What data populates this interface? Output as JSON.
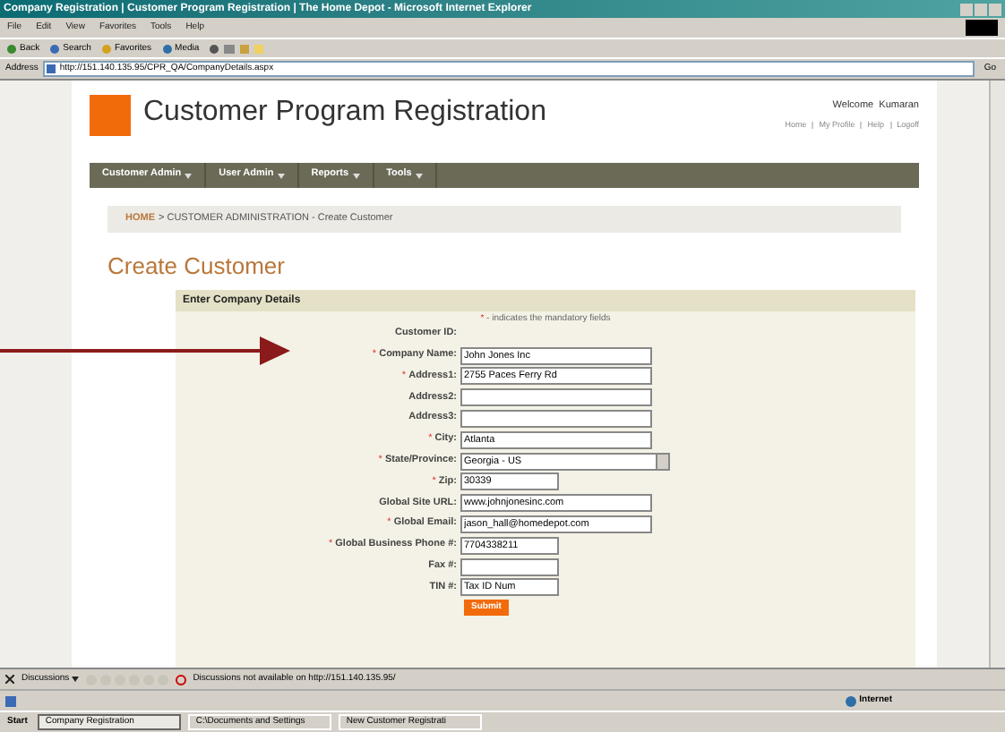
{
  "window": {
    "title": "Company Registration | Customer Program Registration | The Home Depot - Microsoft Internet Explorer"
  },
  "menu": [
    "File",
    "Edit",
    "View",
    "Favorites",
    "Tools",
    "Help"
  ],
  "toolbar": [
    {
      "kind": "back",
      "label": "Back"
    },
    {
      "kind": "search",
      "label": "Search"
    },
    {
      "kind": "favorites",
      "label": "Favorites"
    },
    {
      "kind": "media",
      "label": "Media"
    }
  ],
  "address": {
    "label": "Address",
    "url": "http://151.140.135.95/CPR_QA/CompanyDetails.aspx",
    "go": "Go"
  },
  "site": {
    "title": "Customer Program Registration",
    "welcome": "Welcome  Kumaran",
    "links": [
      "Home",
      "My Profile",
      "Help",
      "Logoff"
    ]
  },
  "nav": [
    "Customer Admin",
    "User Admin",
    "Reports",
    "Tools"
  ],
  "breadcrumb": {
    "home": "HOME",
    "trail": "> CUSTOMER ADMINISTRATION - Create Customer"
  },
  "heading": "Create Customer",
  "form": {
    "title": "Enter Company Details",
    "note_mark": "*",
    "note": " - indicates the mandatory fields",
    "fields": [
      {
        "kind": "none",
        "label": "Customer ID:",
        "required": false
      },
      {
        "kind": "text",
        "label": "Company Name:",
        "required": true,
        "value": "John Jones Inc"
      },
      {
        "kind": "text",
        "label": "Address1:",
        "required": true,
        "value": "2755 Paces Ferry Rd"
      },
      {
        "kind": "text",
        "label": "Address2:",
        "required": false
      },
      {
        "kind": "text",
        "label": "Address3:",
        "required": false
      },
      {
        "kind": "text",
        "label": "City:",
        "required": true,
        "value": "Atlanta"
      },
      {
        "kind": "select",
        "label": "State/Province:",
        "required": true,
        "value": "Georgia - US"
      },
      {
        "kind": "short",
        "label": "Zip:",
        "required": true,
        "value": "30339"
      },
      {
        "kind": "text",
        "label": "Global Site URL:",
        "required": false,
        "value": "www.johnjonesinc.com"
      },
      {
        "kind": "text",
        "label": "Global Email:",
        "required": true,
        "value": "jason_hall@homedepot.com"
      },
      {
        "kind": "short",
        "label": "Global Business Phone #:",
        "required": true,
        "value": "7704338211"
      },
      {
        "kind": "short",
        "label": "Fax #:",
        "required": false
      },
      {
        "kind": "short",
        "label": "TIN #:",
        "required": false,
        "value": "Tax ID Num"
      }
    ],
    "submit": "Submit"
  },
  "discussions": {
    "label": "Discussions",
    "message": "Discussions not available on http://151.140.135.95/"
  },
  "status_bar": {
    "zone": "Internet"
  },
  "taskbar": {
    "start": "Start",
    "tasks": [
      {
        "label": "Company Registration",
        "selected": true
      },
      {
        "label": "C:\\Documents and Settings",
        "selected": false
      },
      {
        "label": "New Customer Registrati",
        "selected": false
      }
    ]
  }
}
